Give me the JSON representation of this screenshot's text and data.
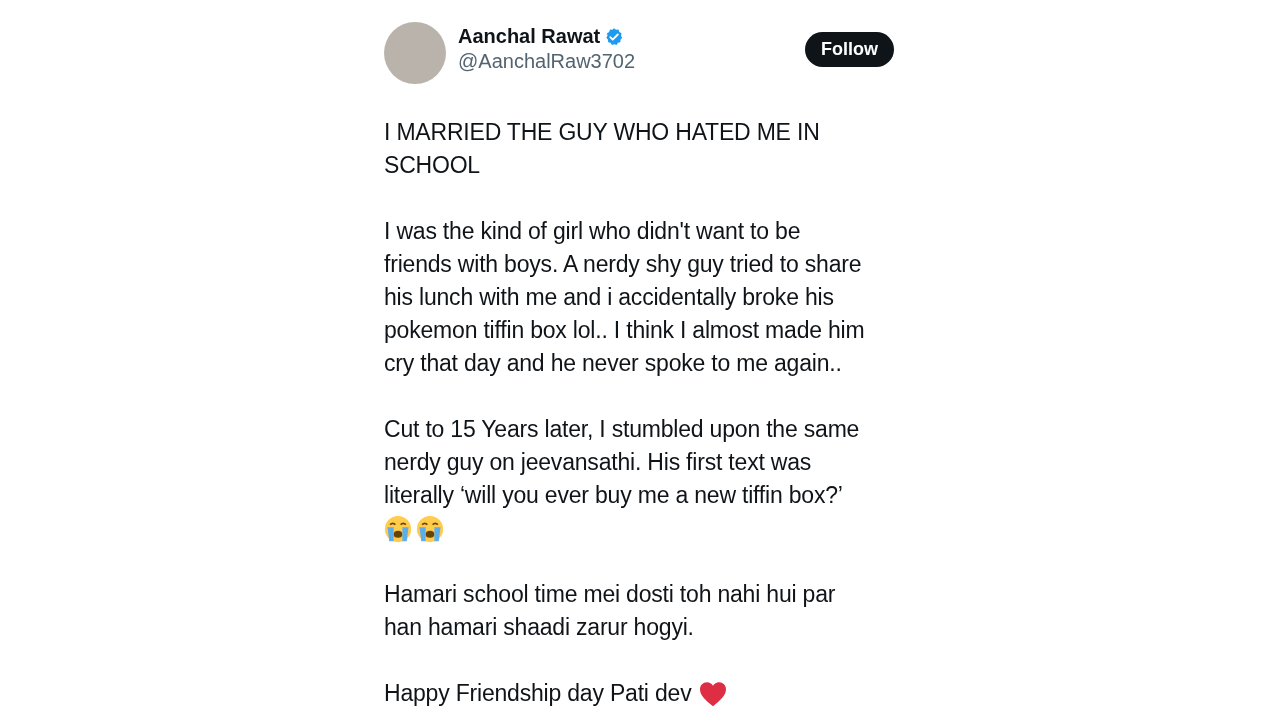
{
  "author": {
    "name": "Aanchal Rawat",
    "verified": true,
    "handle": "@AanchalRaw3702"
  },
  "follow_button": {
    "label": "Follow"
  },
  "paragraphs": [
    {
      "kind": "text",
      "lines": [
        "I MARRIED THE GUY WHO HATED ME IN",
        "SCHOOL"
      ]
    },
    {
      "kind": "text",
      "lines": [
        "I was the kind of girl who didn't want to be",
        "friends with boys. A nerdy shy guy tried to share",
        "his lunch with me and i accidentally broke his",
        "pokemon tiffin box lol.. I think I almost made him",
        "cry that day and he never spoke to me again.."
      ]
    },
    {
      "kind": "text",
      "lines": [
        "Cut to 15 Years later, I stumbled upon the same",
        "nerdy guy on jeevansathi. His first text was",
        "literally ‘will you ever buy me a new tiffin box?’"
      ],
      "emojis": [
        {
          "kind": "crying"
        },
        {
          "kind": "crying"
        }
      ]
    },
    {
      "kind": "text",
      "lines": [
        "Hamari school time mei dosti toh nahi hui par",
        "han hamari shaadi zarur hogyi."
      ]
    },
    {
      "kind": "text_heart",
      "lines": [
        "Happy Friendship day Pati dev"
      ]
    }
  ]
}
